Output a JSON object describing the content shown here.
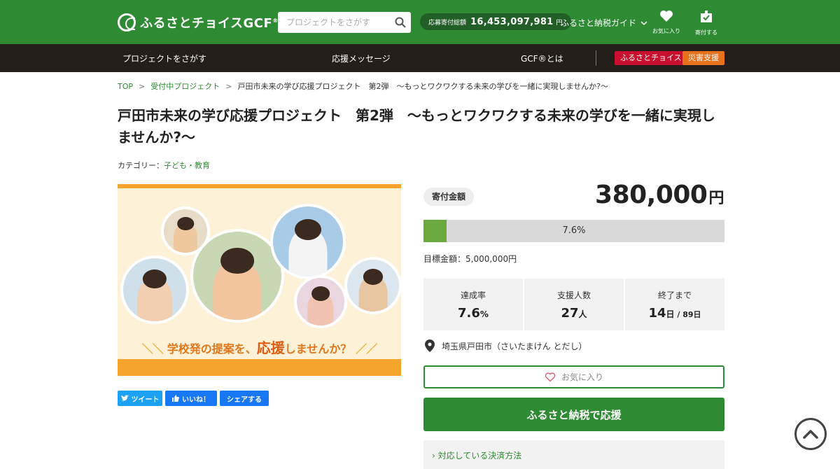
{
  "header": {
    "logo_text": "ふるさとチョイスGCF",
    "logo_mark": "®",
    "search_placeholder": "プロジェクトをさがす",
    "total_label": "応募寄付総額",
    "total_value": "16,453,097,981",
    "total_unit": "円",
    "guide_label": "ふるさと納税ガイド",
    "favorites_label": "お気に入り",
    "donate_label": "寄付する"
  },
  "nav": {
    "items": [
      "プロジェクトをさがす",
      "応援メッセージ",
      "GCF®とは"
    ],
    "badges": [
      "ふるさとチョイス",
      "災害支援"
    ]
  },
  "breadcrumb": [
    "TOP",
    "受付中プロジェクト",
    "戸田市未来の学び応援プロジェクト　第2弾　～もっとワクワクする未来の学びを一緒に実現しませんか?～"
  ],
  "project": {
    "title": "戸田市未来の学び応援プロジェクト　第2弾　～もっとワクワクする未来の学びを一緒に実現しませんか?～",
    "category_label": "カテゴリー：",
    "category_value": "子ども・教育",
    "hero_caption_pre": "学校発の提案を、",
    "hero_caption_big": "応援",
    "hero_caption_post": "しませんか？"
  },
  "social": {
    "tweet": "ツイート",
    "like": "いいね！",
    "share": "シェアする"
  },
  "funding": {
    "label": "寄付金額",
    "amount": "380,000",
    "amount_unit": "円",
    "progress_percent": 7.6,
    "progress_label": "7.6%",
    "goal_label": "目標金額：",
    "goal_value": "5,000,000円"
  },
  "stats": [
    {
      "label": "達成率",
      "value": "7.6",
      "unit": "%",
      "sub": ""
    },
    {
      "label": "支援人数",
      "value": "27",
      "unit": "人",
      "sub": ""
    },
    {
      "label": "終了まで",
      "value": "14",
      "unit": "日",
      "sub": " / 89日"
    }
  ],
  "location": "埼玉県戸田市（さいたまけん とだし）",
  "buttons": {
    "favorite": "お気に入り",
    "donate": "ふるさと納税で応援",
    "payment": "対応している決済方法"
  },
  "colors": {
    "brand_green": "#2f8a34",
    "nav_dark": "#231e19",
    "badge_red": "#c8102e",
    "badge_orange": "#e8711c",
    "twitter_blue": "#1da1f2",
    "facebook_blue": "#1877f2"
  },
  "icons": [
    "search-icon",
    "chevron-down-icon",
    "heart-icon",
    "gift-box-icon",
    "twitter-icon",
    "thumbs-up-icon",
    "map-pin-icon",
    "chevron-right-icon",
    "chevron-up-icon"
  ]
}
